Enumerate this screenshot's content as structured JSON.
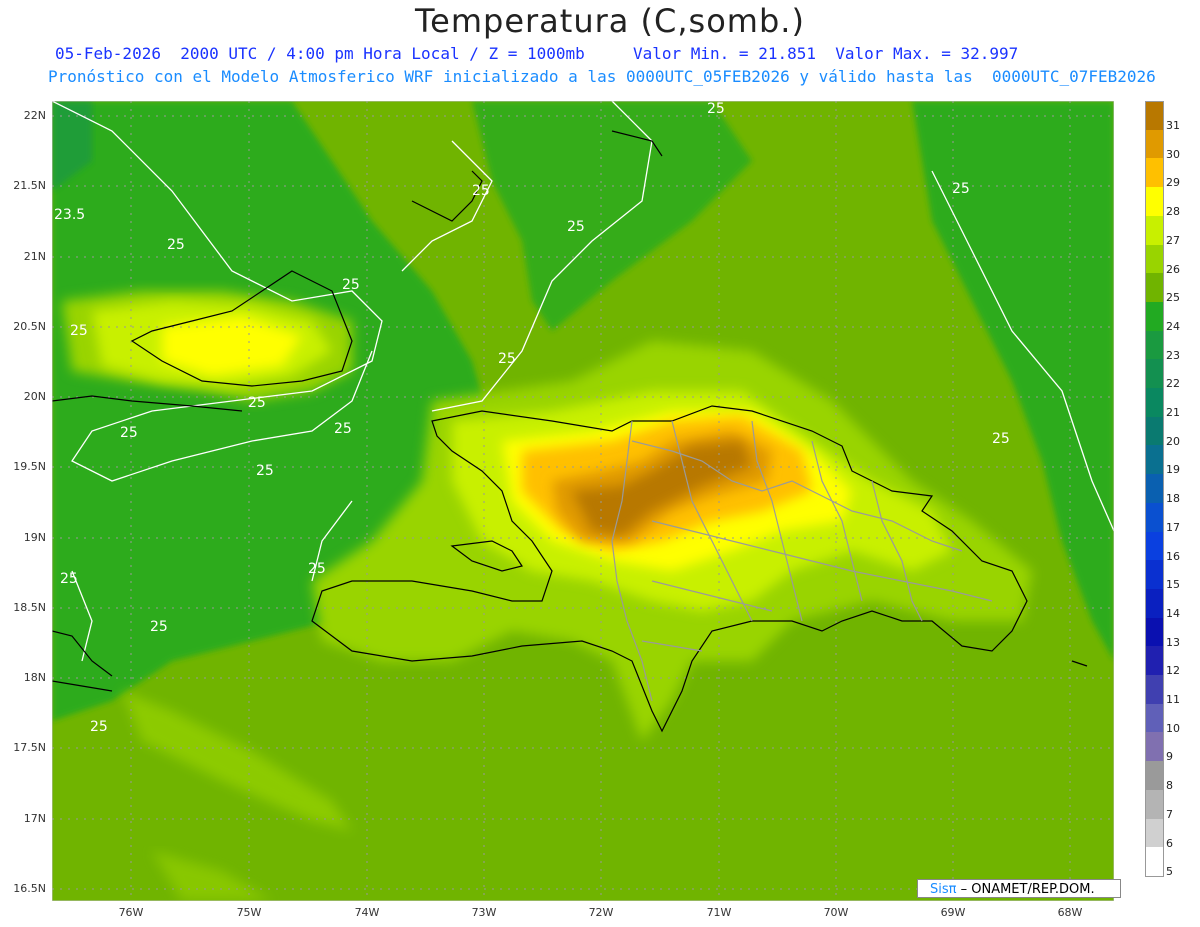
{
  "title": "Temperatura (C,somb.)",
  "subtitle_line1": "05-Feb-2026  2000 UTC / 4:00 pm Hora Local / Z = 1000mb     Valor Min. = 21.851  Valor Max. = 32.997",
  "subtitle_line2": "Pronóstico con el Modelo Atmosferico WRF inicializado a las 0000UTC_05FEB2026 y válido hasta las  0000UTC_07FEB2026",
  "credit_brand": "Sisπ",
  "credit_text": "– ONAMET/REP.DOM.",
  "lat_labels": [
    "22N",
    "21.5N",
    "21N",
    "20.5N",
    "20N",
    "19.5N",
    "19N",
    "18.5N",
    "18N",
    "17.5N",
    "17N",
    "16.5N"
  ],
  "lon_labels": [
    "76W",
    "75W",
    "74W",
    "73W",
    "72W",
    "71W",
    "70W",
    "69W",
    "68W"
  ],
  "contour_labels": [
    "25",
    "25",
    "25",
    "25",
    "25",
    "25",
    "25",
    "25",
    "25",
    "25",
    "25",
    "25",
    "25",
    "25",
    "25",
    "25",
    "25",
    "23.5"
  ],
  "colorbar": {
    "levels": [
      "31",
      "30",
      "29",
      "28",
      "27",
      "26",
      "25",
      "24",
      "23",
      "22",
      "21",
      "20",
      "19",
      "18",
      "17",
      "16",
      "15",
      "14",
      "13",
      "12",
      "11",
      "10",
      "9",
      "8",
      "7",
      "6",
      "5"
    ],
    "colors": [
      "#b87800",
      "#e09a00",
      "#ffc000",
      "#ffff00",
      "#c8f000",
      "#99d400",
      "#70b400",
      "#22aa22",
      "#1a9a40",
      "#139050",
      "#0a8860",
      "#0a7a70",
      "#0a7090",
      "#0a60b0",
      "#0a50d0",
      "#0a40e0",
      "#0a30d0",
      "#0a20c0",
      "#0a10b0",
      "#2020b0",
      "#4040b0",
      "#6060b8",
      "#8070b0",
      "#9a9a9a",
      "#b4b4b4",
      "#d0d0d0",
      "#ffffff"
    ]
  }
}
